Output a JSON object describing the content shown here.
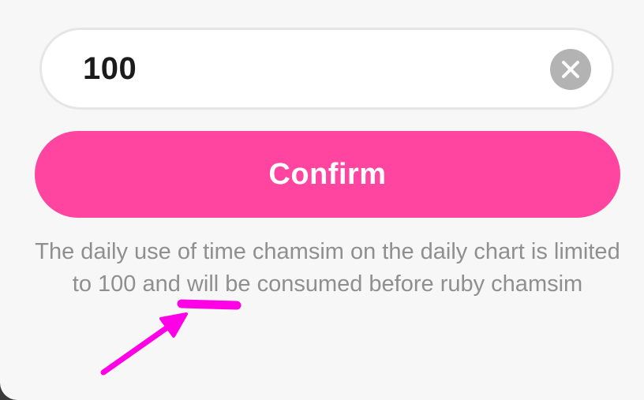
{
  "amount_field": {
    "value": "100",
    "clear_icon": "close-icon"
  },
  "confirm_button": {
    "label": "Confirm",
    "color": "#ff45a0"
  },
  "notice": {
    "before": "The daily use of time chamsim on the daily chart is limited to",
    "limit": "100",
    "after": "and will be consumed before ruby chamsim"
  },
  "annotation": {
    "color": "#ff00e6",
    "icon": "arrow-icon"
  }
}
